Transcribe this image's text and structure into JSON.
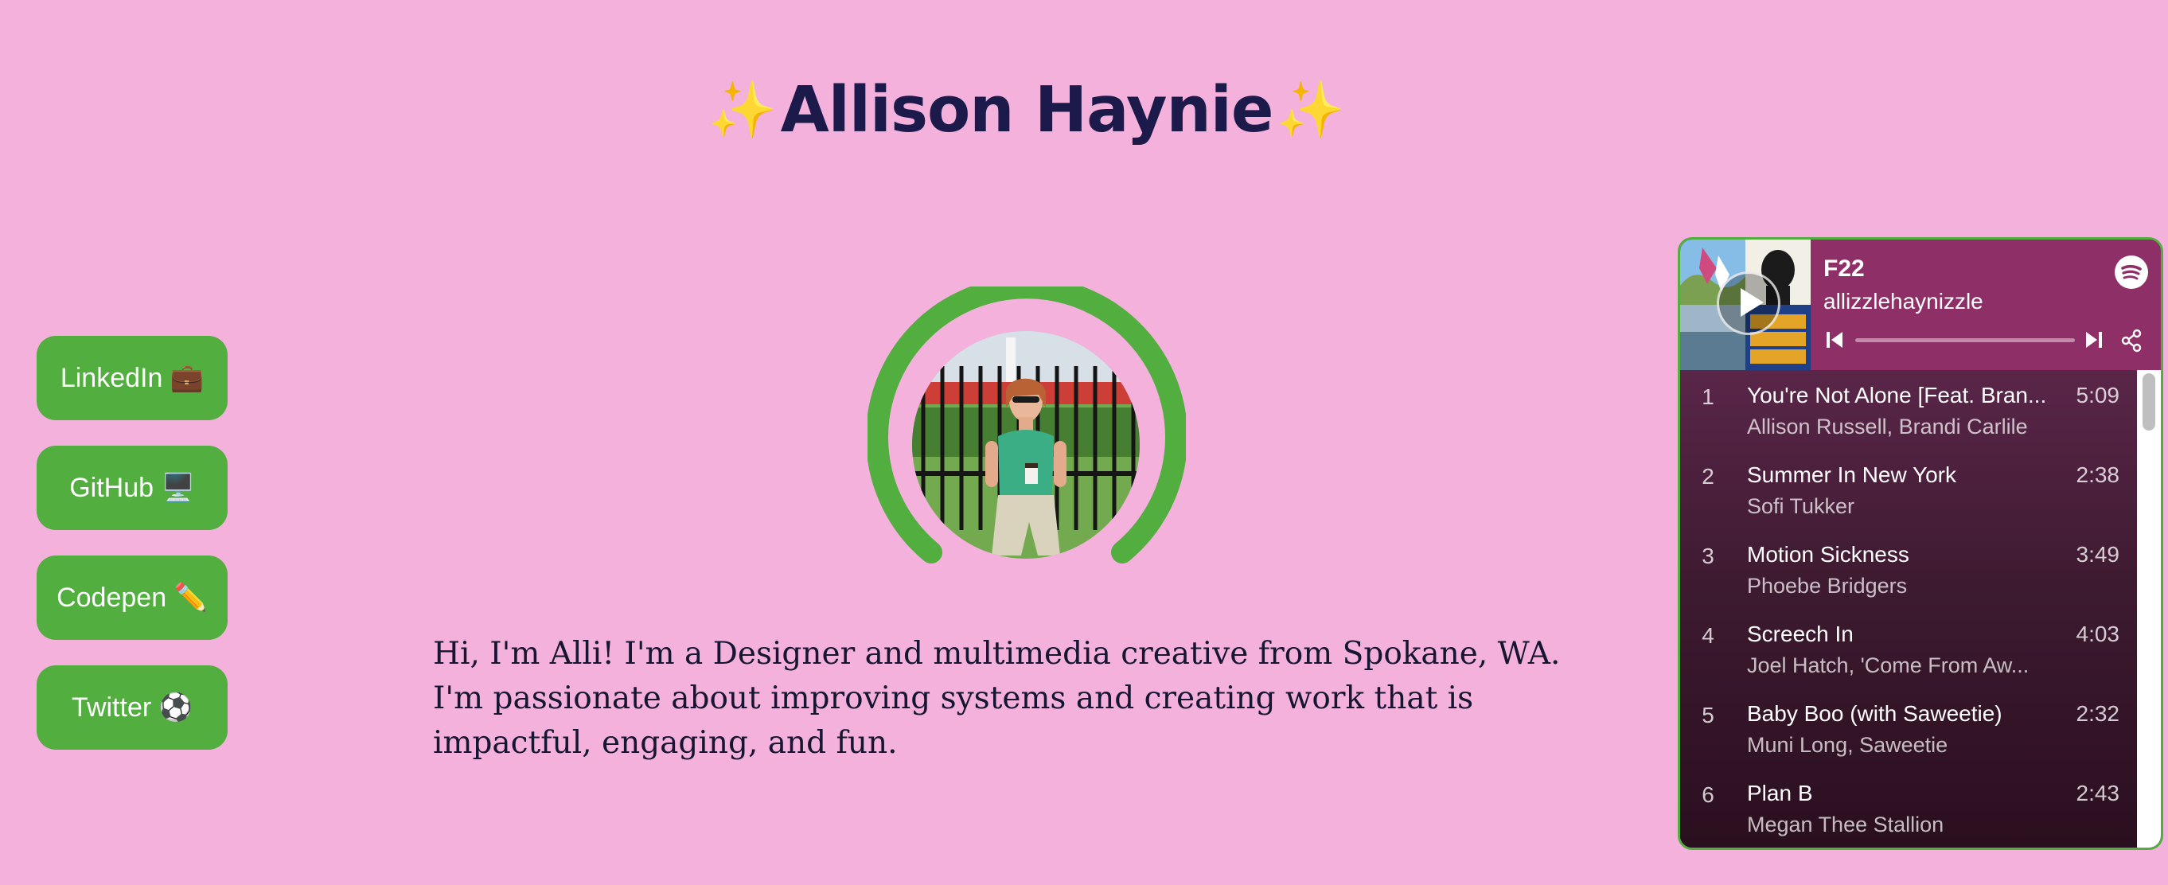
{
  "header": {
    "title": "Allison Haynie",
    "sparkle": "✨"
  },
  "nav": {
    "buttons": [
      {
        "label": "LinkedIn 💼"
      },
      {
        "label": "GitHub 🖥️"
      },
      {
        "label": "Codepen ✏️"
      },
      {
        "label": "Twitter ⚽"
      }
    ]
  },
  "intro": {
    "text": "Hi, I'm Alli! I'm a Designer and multimedia creative from Spokane, WA. I'm passionate about improving systems and creating work that is impactful, engaging, and fun."
  },
  "player": {
    "playlist_name": "F22",
    "owner": "allizzlehaynizzle",
    "progress": 0,
    "tracks": [
      {
        "number": "1",
        "title": "You're Not Alone [Feat. Bran...",
        "artist": "Allison Russell, Brandi Carlile",
        "duration": "5:09"
      },
      {
        "number": "2",
        "title": "Summer In New York",
        "artist": "Sofi Tukker",
        "duration": "2:38"
      },
      {
        "number": "3",
        "title": "Motion Sickness",
        "artist": "Phoebe Bridgers",
        "duration": "3:49"
      },
      {
        "number": "4",
        "title": "Screech In",
        "artist": "Joel Hatch, 'Come From Aw...",
        "duration": "4:03"
      },
      {
        "number": "5",
        "title": "Baby Boo (with Saweetie)",
        "artist": "Muni Long, Saweetie",
        "duration": "2:32"
      },
      {
        "number": "6",
        "title": "Plan B",
        "artist": "Megan Thee Stallion",
        "duration": "2:43"
      }
    ]
  },
  "colors": {
    "background": "#f3b1dc",
    "accent_green": "#52ae3f",
    "title_navy": "#1b1a4a",
    "player_header": "#8f2f68"
  },
  "icons": [
    "sparkle-icon",
    "play-icon",
    "spotify-icon",
    "skip-back-icon",
    "skip-forward-icon",
    "share-icon"
  ]
}
